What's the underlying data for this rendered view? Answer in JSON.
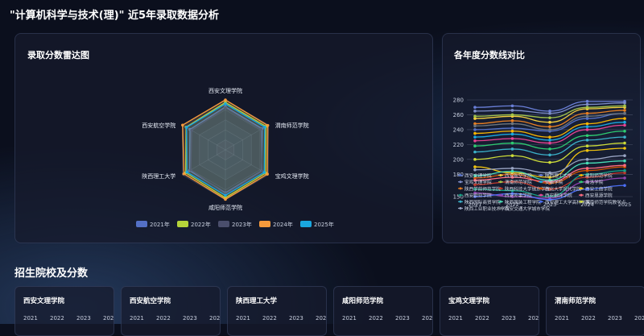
{
  "page": {
    "title": "\"计算机科学与技术(理)\" 近5年录取数据分析"
  },
  "radar": {
    "title": "录取分数雷达图",
    "axes": [
      "西安文理学院",
      "渭南师范学院",
      "宝鸡文理学院",
      "咸阳师范学院",
      "陕西理工大学",
      "西安航空学院"
    ]
  },
  "line": {
    "title": "各年度分数线对比"
  },
  "section": {
    "title": "招生院校及分数"
  },
  "schools": [
    {
      "name": "西安文理学院",
      "years": [
        "2021",
        "2022",
        "2023",
        "2024"
      ]
    },
    {
      "name": "西安航空学院",
      "years": [
        "2021",
        "2022",
        "2023",
        "2024"
      ]
    },
    {
      "name": "陕西理工大学",
      "years": [
        "2021",
        "2022",
        "2023",
        "2024"
      ]
    },
    {
      "name": "咸阳师范学院",
      "years": [
        "2021",
        "2022",
        "2023",
        "2024"
      ]
    },
    {
      "name": "宝鸡文理学院",
      "years": [
        "2021",
        "2022",
        "2023",
        "2024"
      ]
    },
    {
      "name": "渭南师范学院",
      "years": [
        "2021",
        "2022",
        "2023",
        "2024"
      ]
    }
  ],
  "colors": {
    "y2021": "#5470c6",
    "y2022": "#b5d43a",
    "y2023": "#4a4e6c",
    "y2024": "#f59a3c",
    "y2025": "#1aa7e0"
  },
  "chart_data": [
    {
      "type": "radar",
      "title": "录取分数雷达图",
      "indicators": [
        "西安文理学院",
        "渭南师范学院",
        "宝鸡文理学院",
        "咸阳师范学院",
        "陕西理工大学",
        "西安航空学院"
      ],
      "max": 100,
      "legend_position": "bottom",
      "series": [
        {
          "name": "2021年",
          "color": "#5470c6",
          "values": [
            86,
            85,
            84,
            86,
            83,
            82
          ]
        },
        {
          "name": "2022年",
          "color": "#b5d43a",
          "values": [
            95,
            94,
            93,
            96,
            92,
            91
          ]
        },
        {
          "name": "2023年",
          "color": "#4a4e6c",
          "values": [
            84,
            82,
            85,
            88,
            80,
            78
          ]
        },
        {
          "name": "2024年",
          "color": "#f59a3c",
          "values": [
            100,
            98,
            97,
            99,
            96,
            99
          ]
        },
        {
          "name": "2025年",
          "color": "#1aa7e0",
          "values": [
            92,
            91,
            90,
            91,
            89,
            90
          ]
        }
      ]
    },
    {
      "type": "line",
      "title": "各年度分数线对比",
      "categories": [
        "2021",
        "2022",
        "2023",
        "2024",
        "2025"
      ],
      "ylim": [
        150,
        280
      ],
      "yticks": [
        150,
        180,
        200,
        220,
        240,
        260,
        280
      ],
      "legend_position": "bottom",
      "series": [
        {
          "name": "西安文理学院",
          "color": "#5470c6",
          "values": [
            240,
            242,
            238,
            255,
            262
          ]
        },
        {
          "name": "西安航空学院",
          "color": "#f4d03f",
          "values": [
            255,
            258,
            250,
            268,
            270
          ]
        },
        {
          "name": "陕西理工大学",
          "color": "#6a7fd8",
          "values": [
            270,
            272,
            265,
            278,
            278
          ]
        },
        {
          "name": "咸阳师范学院",
          "color": "#f7b500",
          "values": [
            235,
            238,
            230,
            248,
            255
          ]
        },
        {
          "name": "宝鸡文理学院",
          "color": "#7e8ec9",
          "values": [
            265,
            266,
            262,
            274,
            276
          ]
        },
        {
          "name": "渭南师范学院",
          "color": "#a3c44a",
          "values": [
            258,
            260,
            256,
            270,
            272
          ]
        },
        {
          "name": "安康学院",
          "color": "#1aa7e0",
          "values": [
            230,
            234,
            226,
            244,
            250
          ]
        },
        {
          "name": "商洛学院",
          "color": "#2ecc71",
          "values": [
            218,
            222,
            214,
            232,
            238
          ]
        },
        {
          "name": "陕西学前师范学院",
          "color": "#e67e22",
          "values": [
            248,
            252,
            244,
            262,
            266
          ]
        },
        {
          "name": "陕西科技大学镐京学院",
          "color": "#c0392b",
          "values": [
            166,
            170,
            160,
            176,
            182
          ]
        },
        {
          "name": "西北大学现代学院",
          "color": "#d35400",
          "values": [
            175,
            180,
            168,
            185,
            190
          ]
        },
        {
          "name": "西安工商学院",
          "color": "#f1c40f",
          "values": [
            190,
            182,
            176,
            212,
            215
          ]
        },
        {
          "name": "西安欧亚学院",
          "color": "#16a085",
          "values": [
            160,
            158,
            150,
            180,
            185
          ]
        },
        {
          "name": "西安外事学院",
          "color": "#8e44ad",
          "values": [
            155,
            150,
            148,
            170,
            175
          ]
        },
        {
          "name": "西安翻译学院",
          "color": "#e84393",
          "values": [
            225,
            228,
            222,
            240,
            246
          ]
        },
        {
          "name": "西安思源学院",
          "color": "#ff6b81",
          "values": [
            172,
            176,
            170,
            188,
            192
          ]
        },
        {
          "name": "陕西国际商贸学院",
          "color": "#3bb1c9",
          "values": [
            210,
            214,
            206,
            226,
            230
          ]
        },
        {
          "name": "陕西服装工程学院",
          "color": "#48dbb5",
          "values": [
            178,
            184,
            172,
            195,
            198
          ]
        },
        {
          "name": "西安理工大学高科学院",
          "color": "#4c6ef5",
          "values": [
            150,
            154,
            146,
            160,
            165
          ]
        },
        {
          "name": "渭南师范学院教学点",
          "color": "#cddc39",
          "values": [
            200,
            205,
            196,
            218,
            222
          ]
        },
        {
          "name": "陕西工业职业技术学院",
          "color": "#9aa5c4",
          "values": [
            186,
            188,
            182,
            200,
            205
          ]
        },
        {
          "name": "西安交通大学城市学院",
          "color": "#6c757d",
          "values": [
            245,
            248,
            240,
            258,
            262
          ]
        }
      ]
    }
  ]
}
